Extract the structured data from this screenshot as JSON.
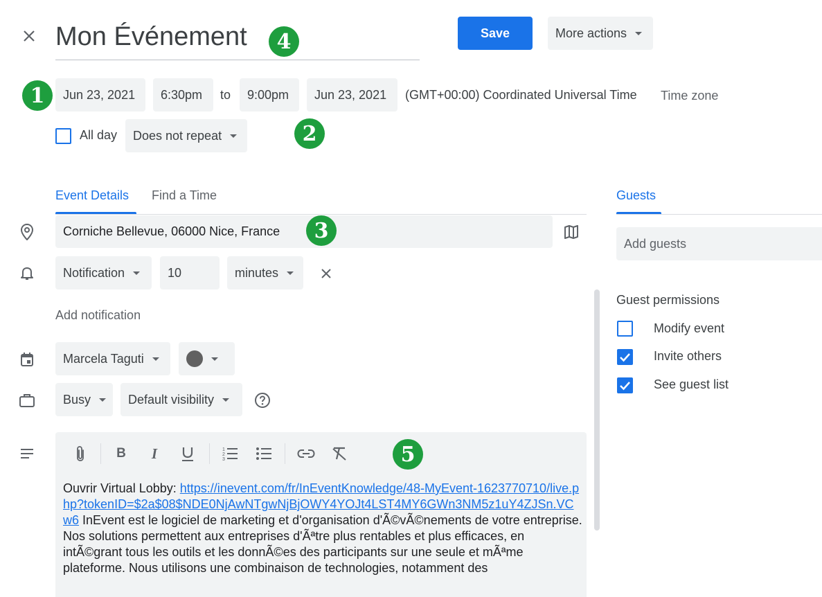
{
  "header": {
    "close_icon": "close-icon",
    "title": "Mon Événement",
    "save_label": "Save",
    "more_actions_label": "More actions"
  },
  "datetime": {
    "start_date": "Jun 23, 2021",
    "start_time": "6:30pm",
    "to_label": "to",
    "end_time": "9:00pm",
    "end_date": "Jun 23, 2021",
    "timezone_text": "(GMT+00:00) Coordinated Universal Time",
    "timezone_button": "Time zone",
    "all_day_label": "All day",
    "all_day_checked": false,
    "repeat_value": "Does not repeat"
  },
  "tabs": [
    {
      "label": "Event Details",
      "active": true
    },
    {
      "label": "Find a Time",
      "active": false
    }
  ],
  "details": {
    "location": "Corniche Bellevue, 06000 Nice, France",
    "notification_type": "Notification",
    "notification_value": "10",
    "notification_unit": "minutes",
    "add_notification": "Add notification",
    "calendar_owner": "Marcela Taguti",
    "event_color": "#616161",
    "busy_status": "Busy",
    "visibility": "Default visibility",
    "description_prefix": "Ouvrir Virtual Lobby: ",
    "description_link": "https://inevent.com/fr/InEventKnowledge/48-MyEvent-1623770710/live.php?tokenID=$2a$08$NDE0NjAwNTgwNjBjOWY4YOJt4LST4MY6GWn3NM5z1uY4ZJSn.VCw6",
    "description_text": " InEvent est le logiciel de marketing et d'organisation d'Ã©vÃ©nements de votre entreprise. Nos solutions permettent aux entreprises d'Ãªtre plus rentables et plus efficaces, en intÃ©grant tous les outils et les donnÃ©es des participants sur une seule et mÃªme plateforme. Nous utilisons une combinaison de technologies, notamment des"
  },
  "guests": {
    "tab_label": "Guests",
    "add_placeholder": "Add guests",
    "permissions_title": "Guest permissions",
    "permissions": [
      {
        "label": "Modify event",
        "checked": false
      },
      {
        "label": "Invite others",
        "checked": true
      },
      {
        "label": "See guest list",
        "checked": true
      }
    ]
  },
  "badges": [
    "1",
    "2",
    "3",
    "4",
    "5"
  ],
  "colors": {
    "accent": "#1a73e8",
    "badge": "#1e9e3e",
    "chip": "#f1f3f4"
  }
}
